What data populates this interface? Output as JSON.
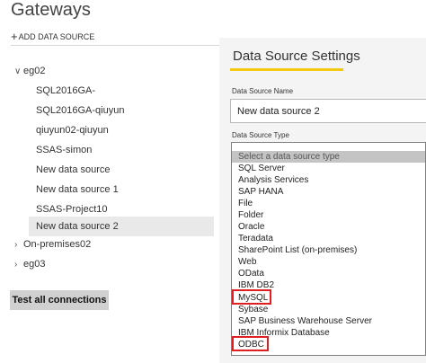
{
  "header": {
    "title": "Gateways"
  },
  "sidebar": {
    "add_label": "ADD DATA SOURCE",
    "groups": [
      {
        "name": "eg02",
        "expanded": true
      },
      {
        "name": "On-premises02",
        "expanded": false
      },
      {
        "name": "eg03",
        "expanded": false
      }
    ],
    "sources": [
      "SQL2016GA-",
      "SQL2016GA-qiuyun",
      "qiuyun02-qiuyun",
      "SSAS-simon",
      "New data source",
      "New data source 1",
      "SSAS-Project10",
      "New data source 2"
    ],
    "selected_source": "New data source 2",
    "test_button": "Test all connections"
  },
  "settings": {
    "title": "Data Source Settings",
    "name_label": "Data Source Name",
    "name_value": "New data source 2",
    "type_label": "Data Source Type",
    "type_placeholder": "Select a data source type",
    "type_options": [
      "SQL Server",
      "Analysis Services",
      "SAP HANA",
      "File",
      "Folder",
      "Oracle",
      "Teradata",
      "SharePoint List (on-premises)",
      "Web",
      "OData",
      "IBM DB2",
      "MySQL",
      "Sybase",
      "SAP Business Warehouse Server",
      "IBM Informix Database",
      "ODBC"
    ],
    "highlighted_options": [
      "MySQL",
      "ODBC"
    ]
  },
  "colors": {
    "accent_underline": "#f2c811",
    "highlight": "#e02020",
    "selected_row": "#e9e9e9",
    "panel_bg": "#f4f4f4"
  }
}
